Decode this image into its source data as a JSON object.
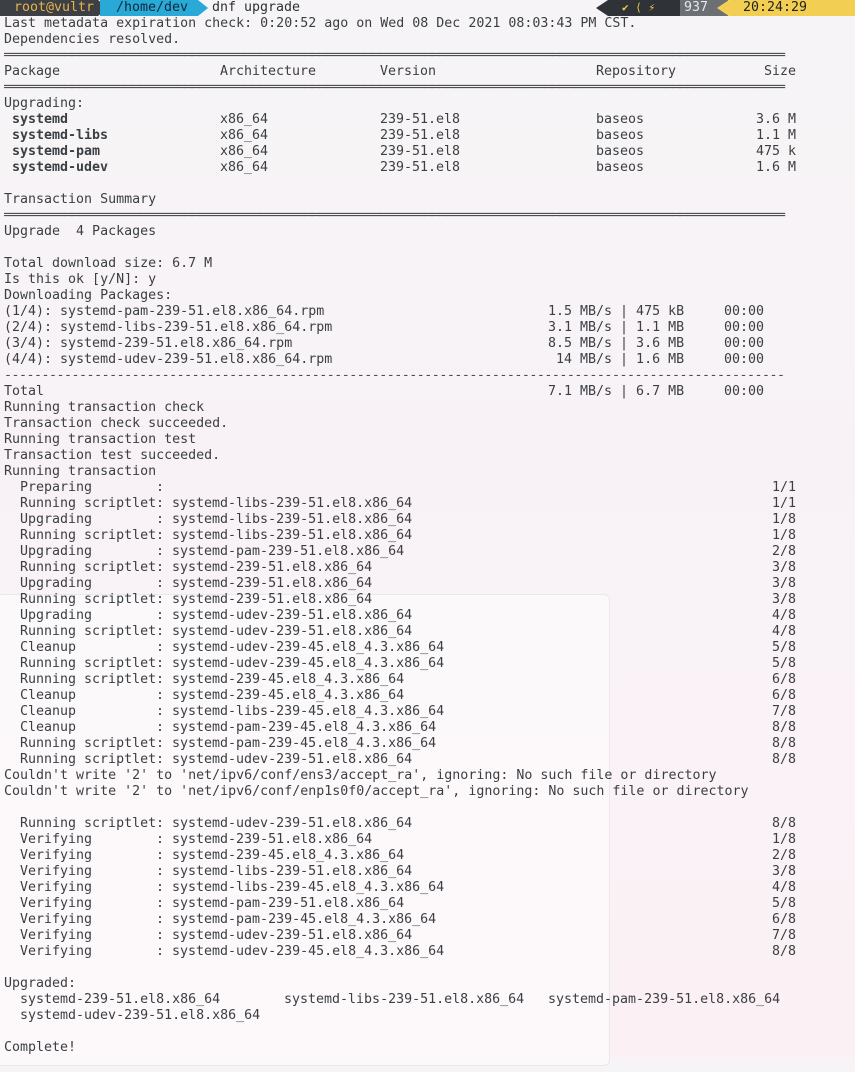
{
  "prompt": {
    "user": "root@vultr",
    "dir": "/home/dev",
    "command": "dnf upgrade",
    "status_icons": "✔ ⟨ ⚡",
    "history": "937",
    "clock": "20:24:29"
  },
  "lines": [
    "Last metadata expiration check: 0:20:52 ago on Wed 08 Dec 2021 08:03:43 PM CST.",
    "Dependencies resolved."
  ],
  "table": {
    "headers": [
      "Package",
      "Architecture",
      "Version",
      "Repository",
      "Size"
    ],
    "section": "Upgrading:",
    "rows": [
      {
        "package": "systemd",
        "arch": "x86_64",
        "version": "239-51.el8",
        "repo": "baseos",
        "size": "3.6 M"
      },
      {
        "package": "systemd-libs",
        "arch": "x86_64",
        "version": "239-51.el8",
        "repo": "baseos",
        "size": "1.1 M"
      },
      {
        "package": "systemd-pam",
        "arch": "x86_64",
        "version": "239-51.el8",
        "repo": "baseos",
        "size": "475 k"
      },
      {
        "package": "systemd-udev",
        "arch": "x86_64",
        "version": "239-51.el8",
        "repo": "baseos",
        "size": "1.6 M"
      }
    ]
  },
  "summary": {
    "title": "Transaction Summary",
    "upgrade": "Upgrade  4 Packages",
    "download_size": "Total download size: 6.7 M",
    "confirm": "Is this ok [y/N]: y",
    "downloading": "Downloading Packages:"
  },
  "downloads": [
    {
      "name": "(1/4): systemd-pam-239-51.el8.x86_64.rpm",
      "rate": "1.5 MB/s | 475 kB",
      "time": "00:00"
    },
    {
      "name": "(2/4): systemd-libs-239-51.el8.x86_64.rpm",
      "rate": "3.1 MB/s | 1.1 MB",
      "time": "00:00"
    },
    {
      "name": "(3/4): systemd-239-51.el8.x86_64.rpm",
      "rate": "8.5 MB/s | 3.6 MB",
      "time": "00:00"
    },
    {
      "name": "(4/4): systemd-udev-239-51.el8.x86_64.rpm",
      "rate": " 14 MB/s | 1.6 MB",
      "time": "00:00"
    }
  ],
  "total": {
    "label": "Total",
    "rate": "7.1 MB/s | 6.7 MB",
    "time": "00:00"
  },
  "transaction": [
    "Running transaction check",
    "Transaction check succeeded.",
    "Running transaction test",
    "Transaction test succeeded.",
    "Running transaction"
  ],
  "steps": [
    {
      "action": "Preparing",
      "target": "",
      "count": "1/1"
    },
    {
      "action": "Running scriptlet",
      "target": "systemd-libs-239-51.el8.x86_64",
      "count": "1/1"
    },
    {
      "action": "Upgrading",
      "target": "systemd-libs-239-51.el8.x86_64",
      "count": "1/8"
    },
    {
      "action": "Running scriptlet",
      "target": "systemd-libs-239-51.el8.x86_64",
      "count": "1/8"
    },
    {
      "action": "Upgrading",
      "target": "systemd-pam-239-51.el8.x86_64",
      "count": "2/8"
    },
    {
      "action": "Running scriptlet",
      "target": "systemd-239-51.el8.x86_64",
      "count": "3/8"
    },
    {
      "action": "Upgrading",
      "target": "systemd-239-51.el8.x86_64",
      "count": "3/8"
    },
    {
      "action": "Running scriptlet",
      "target": "systemd-239-51.el8.x86_64",
      "count": "3/8"
    },
    {
      "action": "Upgrading",
      "target": "systemd-udev-239-51.el8.x86_64",
      "count": "4/8"
    },
    {
      "action": "Running scriptlet",
      "target": "systemd-udev-239-51.el8.x86_64",
      "count": "4/8"
    },
    {
      "action": "Cleanup",
      "target": "systemd-udev-239-45.el8_4.3.x86_64",
      "count": "5/8"
    },
    {
      "action": "Running scriptlet",
      "target": "systemd-udev-239-45.el8_4.3.x86_64",
      "count": "5/8"
    },
    {
      "action": "Running scriptlet",
      "target": "systemd-239-45.el8_4.3.x86_64",
      "count": "6/8"
    },
    {
      "action": "Cleanup",
      "target": "systemd-239-45.el8_4.3.x86_64",
      "count": "6/8"
    },
    {
      "action": "Cleanup",
      "target": "systemd-libs-239-45.el8_4.3.x86_64",
      "count": "7/8"
    },
    {
      "action": "Cleanup",
      "target": "systemd-pam-239-45.el8_4.3.x86_64",
      "count": "8/8"
    },
    {
      "action": "Running scriptlet",
      "target": "systemd-pam-239-45.el8_4.3.x86_64",
      "count": "8/8"
    },
    {
      "action": "Running scriptlet",
      "target": "systemd-udev-239-51.el8.x86_64",
      "count": "8/8"
    }
  ],
  "errors": [
    "Couldn't write '2' to 'net/ipv6/conf/ens3/accept_ra', ignoring: No such file or directory",
    "Couldn't write '2' to 'net/ipv6/conf/enp1s0f0/accept_ra', ignoring: No such file or directory"
  ],
  "verify_steps": [
    {
      "action": "Running scriptlet",
      "target": "systemd-udev-239-51.el8.x86_64",
      "count": "8/8"
    },
    {
      "action": "Verifying",
      "target": "systemd-239-51.el8.x86_64",
      "count": "1/8"
    },
    {
      "action": "Verifying",
      "target": "systemd-239-45.el8_4.3.x86_64",
      "count": "2/8"
    },
    {
      "action": "Verifying",
      "target": "systemd-libs-239-51.el8.x86_64",
      "count": "3/8"
    },
    {
      "action": "Verifying",
      "target": "systemd-libs-239-45.el8_4.3.x86_64",
      "count": "4/8"
    },
    {
      "action": "Verifying",
      "target": "systemd-pam-239-51.el8.x86_64",
      "count": "5/8"
    },
    {
      "action": "Verifying",
      "target": "systemd-pam-239-45.el8_4.3.x86_64",
      "count": "6/8"
    },
    {
      "action": "Verifying",
      "target": "systemd-udev-239-51.el8.x86_64",
      "count": "7/8"
    },
    {
      "action": "Verifying",
      "target": "systemd-udev-239-45.el8_4.3.x86_64",
      "count": "8/8"
    }
  ],
  "upgraded": {
    "title": "Upgraded:",
    "packages": [
      "systemd-239-51.el8.x86_64",
      "systemd-libs-239-51.el8.x86_64",
      "systemd-pam-239-51.el8.x86_64",
      "systemd-udev-239-51.el8.x86_64"
    ]
  },
  "complete": "Complete!"
}
